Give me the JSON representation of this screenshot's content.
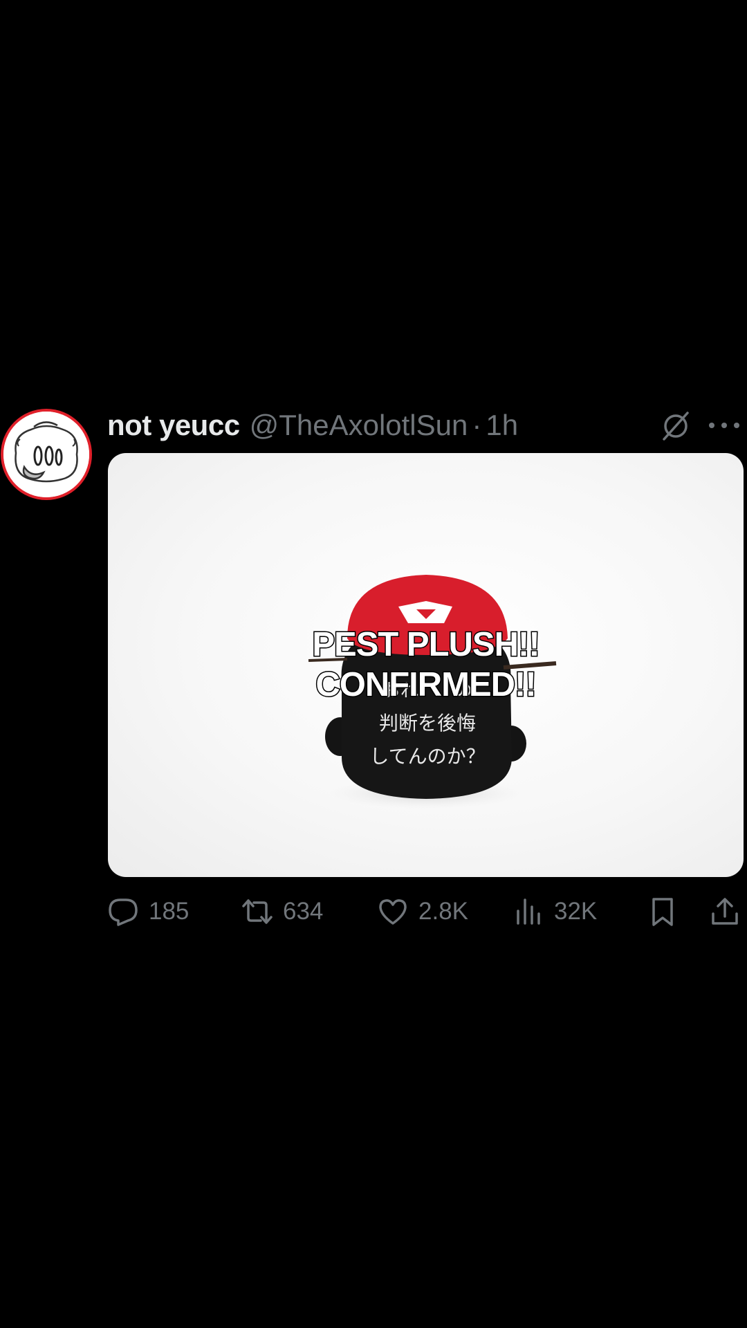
{
  "post": {
    "author_name": "not yeucc",
    "author_handle": "@TheAxolotlSun",
    "separator": "·",
    "time": "1h",
    "media": {
      "caption_line1": "PEST PLUSH!!",
      "caption_line2": "CONFIRMED!!",
      "plush_text_line1": "おれ　　の",
      "plush_text_line2": "判断を後悔",
      "plush_text_line3": "してんのか？"
    },
    "actions": {
      "replies": "185",
      "reposts": "634",
      "likes": "2.8K",
      "views": "32K"
    }
  },
  "icons": {
    "grok": "grok-icon",
    "more": "more-icon",
    "reply": "reply-icon",
    "repost": "repost-icon",
    "like": "like-icon",
    "views": "views-icon",
    "bookmark": "bookmark-icon",
    "share": "share-icon"
  },
  "colors": {
    "background": "#000000",
    "primary_text": "#e7e9ea",
    "secondary_text": "#71767b",
    "avatar_ring": "#e0202a",
    "plush_hat": "#d81e2c"
  }
}
